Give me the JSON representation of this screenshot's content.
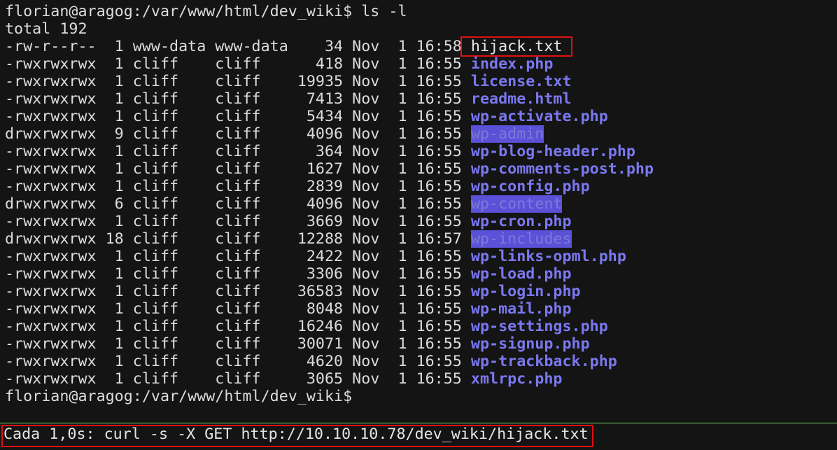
{
  "terminal": {
    "prompt_line": "florian@aragog:/var/www/html/dev_wiki$ ls -l",
    "total_line": "total 192",
    "entries": [
      {
        "meta": "-rw-r--r--  1 www-data www-data    34 Nov  1 16:58 ",
        "name": "hijack.txt"
      },
      {
        "meta": "-rwxrwxrwx  1 cliff    cliff      418 Nov  1 16:55 ",
        "name": "index.php"
      },
      {
        "meta": "-rwxrwxrwx  1 cliff    cliff    19935 Nov  1 16:55 ",
        "name": "license.txt"
      },
      {
        "meta": "-rwxrwxrwx  1 cliff    cliff     7413 Nov  1 16:55 ",
        "name": "readme.html"
      },
      {
        "meta": "-rwxrwxrwx  1 cliff    cliff     5434 Nov  1 16:55 ",
        "name": "wp-activate.php"
      },
      {
        "meta": "drwxrwxrwx  9 cliff    cliff     4096 Nov  1 16:55 ",
        "name": "wp-admin"
      },
      {
        "meta": "-rwxrwxrwx  1 cliff    cliff      364 Nov  1 16:55 ",
        "name": "wp-blog-header.php"
      },
      {
        "meta": "-rwxrwxrwx  1 cliff    cliff     1627 Nov  1 16:55 ",
        "name": "wp-comments-post.php"
      },
      {
        "meta": "-rwxrwxrwx  1 cliff    cliff     2839 Nov  1 16:55 ",
        "name": "wp-config.php"
      },
      {
        "meta": "drwxrwxrwx  6 cliff    cliff     4096 Nov  1 16:55 ",
        "name": "wp-content"
      },
      {
        "meta": "-rwxrwxrwx  1 cliff    cliff     3669 Nov  1 16:55 ",
        "name": "wp-cron.php"
      },
      {
        "meta": "drwxrwxrwx 18 cliff    cliff    12288 Nov  1 16:57 ",
        "name": "wp-includes"
      },
      {
        "meta": "-rwxrwxrwx  1 cliff    cliff     2422 Nov  1 16:55 ",
        "name": "wp-links-opml.php"
      },
      {
        "meta": "-rwxrwxrwx  1 cliff    cliff     3306 Nov  1 16:55 ",
        "name": "wp-load.php"
      },
      {
        "meta": "-rwxrwxrwx  1 cliff    cliff    36583 Nov  1 16:55 ",
        "name": "wp-login.php"
      },
      {
        "meta": "-rwxrwxrwx  1 cliff    cliff     8048 Nov  1 16:55 ",
        "name": "wp-mail.php"
      },
      {
        "meta": "-rwxrwxrwx  1 cliff    cliff    16246 Nov  1 16:55 ",
        "name": "wp-settings.php"
      },
      {
        "meta": "-rwxrwxrwx  1 cliff    cliff    30071 Nov  1 16:55 ",
        "name": "wp-signup.php"
      },
      {
        "meta": "-rwxrwxrwx  1 cliff    cliff     4620 Nov  1 16:55 ",
        "name": "wp-trackback.php"
      },
      {
        "meta": "-rwxrwxrwx  1 cliff    cliff     3065 Nov  1 16:55 ",
        "name": "xmlrpc.php"
      }
    ],
    "final_prompt": "florian@aragog:/var/www/html/dev_wiki$"
  },
  "watch_pane": {
    "status_text": "Cada 1,0s: curl -s -X GET http://10.10.10.78/dev_wiki/hijack.txt"
  },
  "colors": {
    "background": "#141414",
    "text": "#dcdcdc",
    "file_blue": "#7b78f0",
    "dir_highlight": "#5a51d8",
    "annotation_red": "#e01010",
    "pane_divider": "#7ad66e"
  }
}
